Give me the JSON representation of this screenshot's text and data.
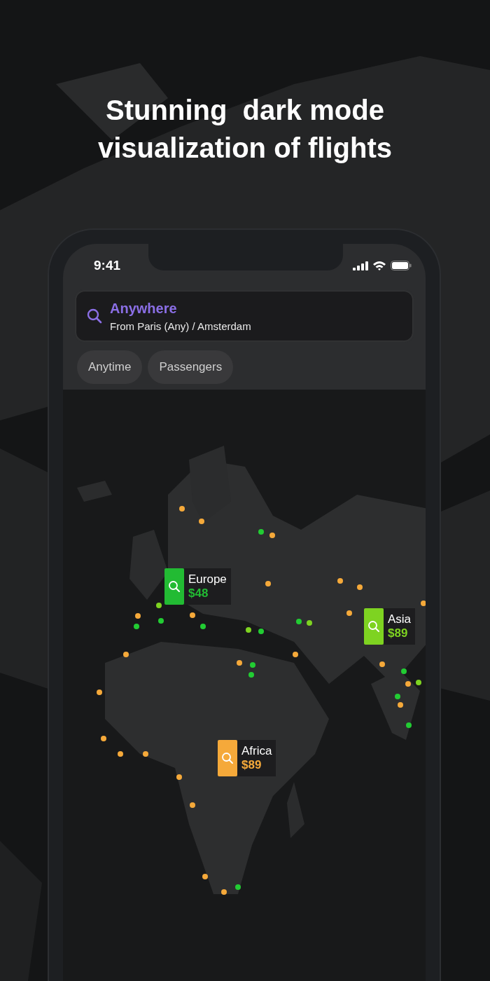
{
  "headline": "Stunning  dark mode visualization of flights",
  "status_bar": {
    "time": "9:41"
  },
  "search": {
    "title": "Anywhere",
    "subtitle": "From Paris (Any) / Amsterdam"
  },
  "filters": [
    {
      "label": "Anytime"
    },
    {
      "label": "Passengers"
    }
  ],
  "markers": [
    {
      "region": "Europe",
      "price": "$48",
      "color": "#22bb33"
    },
    {
      "region": "Asia",
      "price": "$89",
      "color": "#7ed321"
    },
    {
      "region": "Africa",
      "price": "$89",
      "color": "#f5a93a"
    }
  ]
}
